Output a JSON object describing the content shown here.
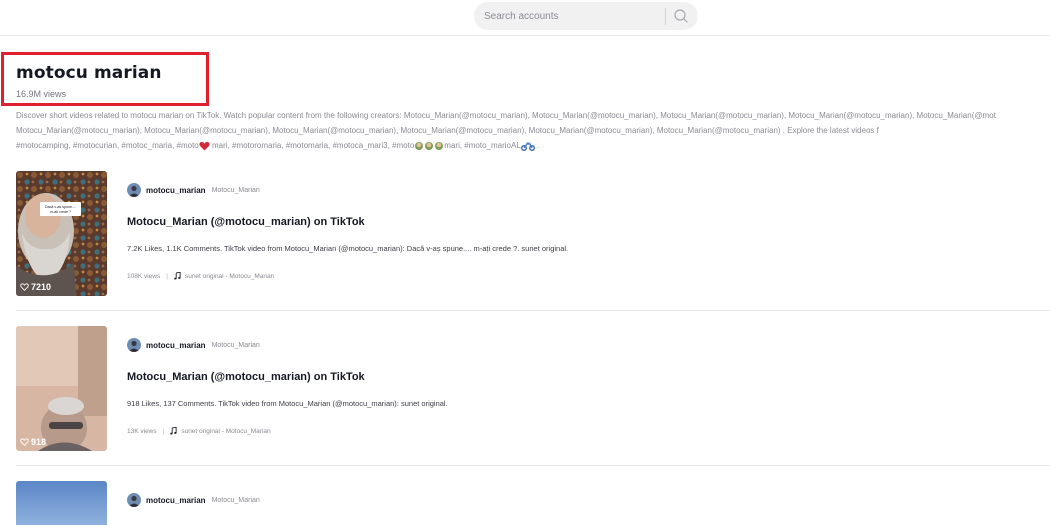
{
  "search": {
    "placeholder": "Search accounts",
    "icon": "search-icon"
  },
  "header": {
    "title": "motocu marian",
    "views": "16.9M views",
    "highlight_color": "#e0202e"
  },
  "description": {
    "line1": "Discover short videos related to motocu marian on TikTok. Watch popular content from the following creators: Motocu_Marian(@motocu_marian), Motocu_Marian(@motocu_marian), Motocu_Marian(@motocu_marian), Motocu_Marian(@motocu_marian), Motocu_Marian(@mot",
    "line2": "Motocu_Marian(@motocu_marian), Motocu_Marian(@motocu_marian), Motocu_Marian(@motocu_marian), Motocu_Marian(@motocu_marian), Motocu_Marian(@motocu_marian), Motocu_Marian(@motocu_marian) . Explore the latest videos f",
    "line3_a": "#motocamping, #motocurian, #motoc_maria, #moto",
    "line3_b": "mari, #motoromaria, #motomaria, #motoca_mari3, #moto",
    "line3_c": "mari, #moto_marioAL",
    "line3_d": "."
  },
  "videos": [
    {
      "username": "motocu_marian",
      "nickname": "Motocu_Marian",
      "title": "Motocu_Marian (@motocu_marian) on TikTok",
      "desc": "7.2K Likes, 1.1K Comments. TikTok video from Motocu_Marian (@motocu_marian): Dacă v-aș spune.... m-ați crede ?. sunet original.",
      "views": "108K views",
      "sound": "sunet original - Motocu_Marian",
      "likes": "7210",
      "overlay_line1": "Dacă v-aș spune....",
      "overlay_line2": "m-ați crede ?"
    },
    {
      "username": "motocu_marian",
      "nickname": "Motocu_Marian",
      "title": "Motocu_Marian (@motocu_marian) on TikTok",
      "desc": "918 Likes, 137 Comments. TikTok video from Motocu_Marian (@motocu_marian): sunet original.",
      "views": "13K views",
      "sound": "sunet original - Motocu_Marian",
      "likes": "918"
    },
    {
      "username": "motocu_marian",
      "nickname": "Motocu_Marian"
    }
  ]
}
